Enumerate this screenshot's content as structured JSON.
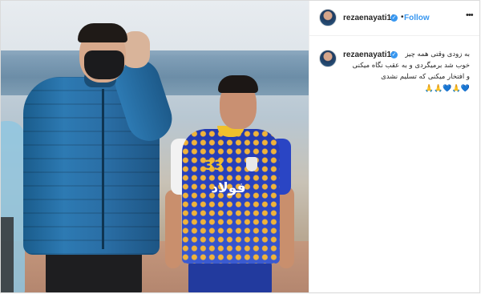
{
  "post": {
    "username": "rezaenayati10",
    "verified_mark": "✓",
    "follow_label": "Follow",
    "separator": "•",
    "more_label": "•••",
    "caption_lines": [
      "به زودی وقتی همه چیز",
      "خوب شد برمیگردی و به عقب نگاه میکنی",
      "و افتخار میکنی که تسلیم نشدی"
    ],
    "caption_emojis": [
      "🙏",
      "🙏",
      "💙",
      "🙏",
      "💙"
    ]
  },
  "photo": {
    "jersey_number": "33",
    "jersey_sponsor": "فولاد"
  },
  "colors": {
    "accent": "#3897f0",
    "border": "#dbdbdb",
    "text": "#262626",
    "coach_jacket": "#2d7ab3",
    "jersey_blue": "#2a45c4",
    "jersey_gold": "#f0c12c"
  },
  "icons": {
    "verified": "verified-badge-icon",
    "more": "more-options-icon",
    "avatar": "profile-avatar"
  }
}
